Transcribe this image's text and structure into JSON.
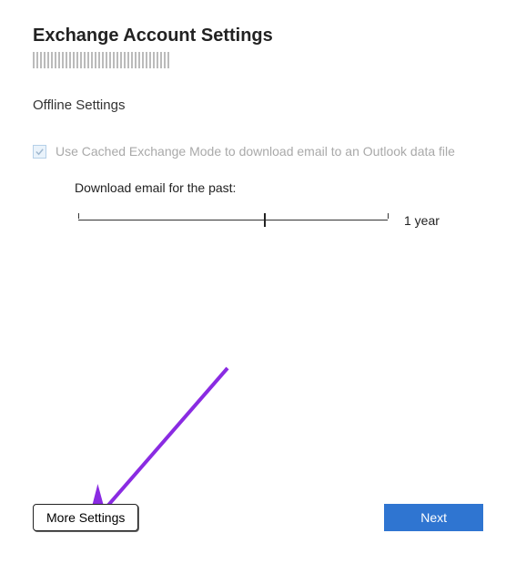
{
  "header": {
    "title": "Exchange Account Settings"
  },
  "offline": {
    "section_label": "Offline Settings",
    "cached_mode_label": "Use Cached Exchange Mode to download email to an Outlook data file",
    "cached_mode_checked": true,
    "download_label": "Download email for the past:",
    "slider_value_label": "1 year",
    "slider_position_percent": 60
  },
  "footer": {
    "more_settings_label": "More Settings",
    "next_label": "Next"
  },
  "colors": {
    "primary": "#2f75d1",
    "arrow": "#8a2be2"
  }
}
